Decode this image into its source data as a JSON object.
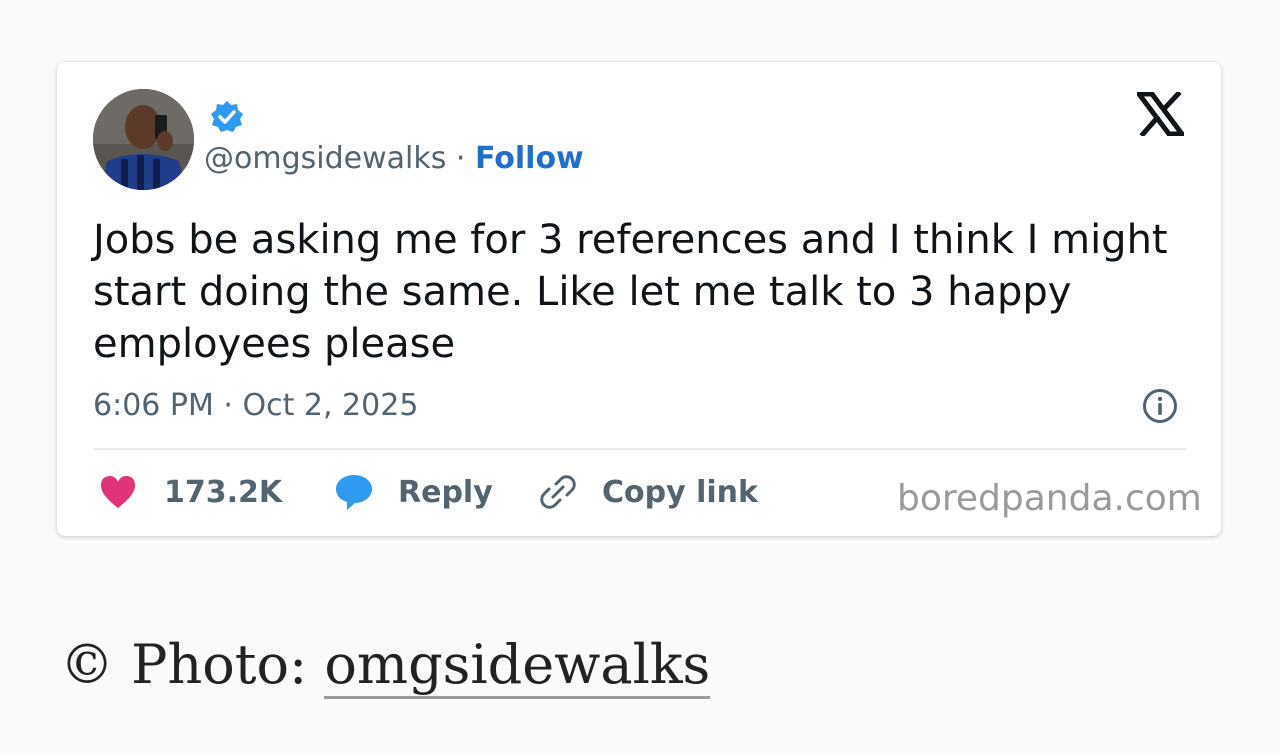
{
  "tweet": {
    "handle": "@omgsidewalks",
    "separator": "·",
    "follow_label": "Follow",
    "text": "Jobs be asking me for 3 references and I think I might start doing the same. Like let me talk to 3 happy employees please",
    "timestamp": "6:06 PM · Oct 2, 2025",
    "actions": {
      "likes_count": "173.2K",
      "reply_label": "Reply",
      "copy_link_label": "Copy link"
    },
    "watermark": "boredpanda.com"
  },
  "caption": {
    "prefix": "© Photo: ",
    "link_text": "omgsidewalks"
  },
  "colors": {
    "link_blue": "#1d6fd1",
    "verified_blue": "#2f9bf0",
    "like_pink": "#e0337a",
    "reply_blue": "#2f9bf0",
    "muted_text": "#536471"
  },
  "icons": {
    "verified": "verified-badge-icon",
    "brand": "x-logo-icon",
    "info": "info-icon",
    "like": "heart-icon",
    "reply": "speech-bubble-icon",
    "copy": "link-icon"
  }
}
